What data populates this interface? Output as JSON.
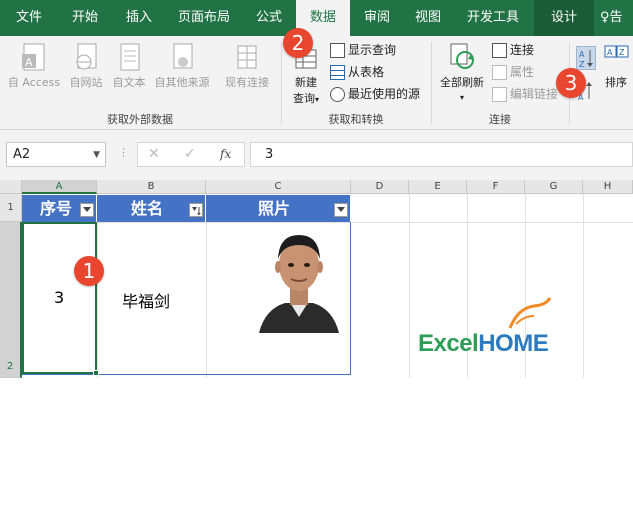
{
  "ribbon_tabs": [
    "文件",
    "开始",
    "插入",
    "页面布局",
    "公式",
    "数据",
    "审阅",
    "视图",
    "开发工具",
    "设计",
    "告"
  ],
  "active_tab": "数据",
  "get_external": {
    "buttons": [
      "自 Access",
      "自网站",
      "自文本",
      "自其他来源",
      "现有连接"
    ],
    "label": "获取外部数据"
  },
  "get_transform": {
    "new_query": [
      "新建",
      "查询"
    ],
    "items": [
      "显示查询",
      "从表格",
      "最近使用的源"
    ],
    "label": "获取和转换"
  },
  "connections": {
    "refresh": "全部刷新",
    "items": [
      "连接",
      "属性",
      "编辑链接"
    ],
    "label": "连接"
  },
  "sort": {
    "label": "排序"
  },
  "formula_bar": {
    "name_box": "A2",
    "fx": "fx",
    "value": "3"
  },
  "columns": [
    "A",
    "B",
    "C",
    "D",
    "E",
    "F",
    "G",
    "H"
  ],
  "rows": [
    "1",
    "2"
  ],
  "table": {
    "headers": [
      "序号",
      "姓名",
      "照片"
    ],
    "row": {
      "index": "3",
      "name": "毕福剑"
    }
  },
  "callouts": [
    "1",
    "2",
    "3"
  ],
  "logo": {
    "part1": "Excel",
    "part2": "HOME"
  },
  "colors": {
    "excel_green": "#217346",
    "table_blue": "#4472c4",
    "callout_red": "#e8462f"
  }
}
